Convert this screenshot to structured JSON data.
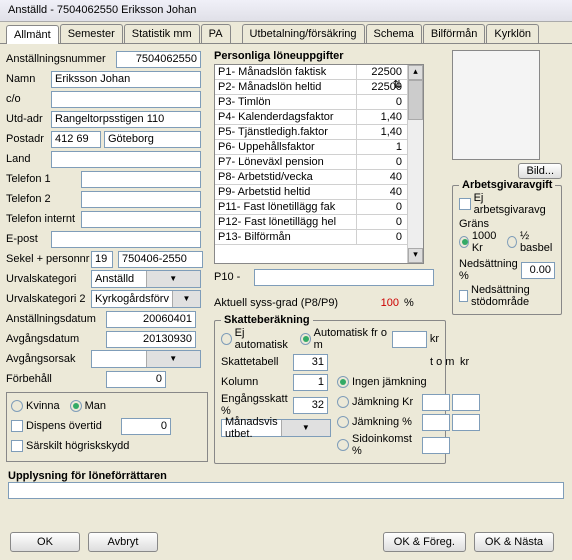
{
  "window": {
    "title": "Anställd - 7504062550  Eriksson Johan"
  },
  "tabs": [
    "Allmänt",
    "Semester",
    "Statistik mm",
    "PA",
    "Utbetalning/försäkring",
    "Schema",
    "Bilförmån",
    "Kyrklön"
  ],
  "active_tab": 0,
  "left": {
    "anst_nr_label": "Anställningsnummer",
    "anst_nr": "7504062550",
    "namn_label": "Namn",
    "namn": "Eriksson Johan",
    "co_label": "c/o",
    "co": "",
    "utd_label": "Utd-adr",
    "utd": "Rangeltorpsstigen 110",
    "post_label": "Postadr",
    "postnr": "412 69",
    "ort": "Göteborg",
    "land_label": "Land",
    "land": "",
    "tel1_label": "Telefon 1",
    "tel1": "",
    "tel2_label": "Telefon 2",
    "tel2": "",
    "telint_label": "Telefon internt",
    "telint": "",
    "epost_label": "E-post",
    "epost": "",
    "sekel_label": "Sekel + personnr",
    "sekel": "19",
    "pnr": "750406-2550",
    "urv1_label": "Urvalskategori",
    "urv1": "Anställd",
    "urv2_label": "Urvalskategori 2",
    "urv2": "Kyrkogårdsförv",
    "anstdat_label": "Anställningsdatum",
    "anstdat": "20060401",
    "avgdat_label": "Avgångsdatum",
    "avgdat": "20130930",
    "avgors_label": "Avgångsorsak",
    "avgors": "",
    "forb_label": "Förbehåll",
    "forb": "0",
    "kvinna_label": "Kvinna",
    "man_label": "Man",
    "dispens_label": "Dispens övertid",
    "dispens_val": "0",
    "hogrisk_label": "Särskilt högriskskydd"
  },
  "personliga": {
    "title": "Personliga löneuppgifter",
    "rows": [
      {
        "l": "P1- Månadslön faktisk",
        "v": "22500"
      },
      {
        "l": "P2- Månadslön heltid",
        "v": "22500"
      },
      {
        "l": "P3- Timlön",
        "v": "0"
      },
      {
        "l": "P4- Kalenderdagsfaktor",
        "v": "1,40"
      },
      {
        "l": "P5- Tjänstledigh.faktor",
        "v": "1,40"
      },
      {
        "l": "P6- Uppehållsfaktor",
        "v": "1"
      },
      {
        "l": "P7- Löneväxl pension",
        "v": "0"
      },
      {
        "l": "P8- Arbetstid/vecka",
        "v": "40"
      },
      {
        "l": "P9- Arbetstid heltid",
        "v": "40"
      },
      {
        "l": "P11- Fast lönetillägg fak",
        "v": "0"
      },
      {
        "l": "P12- Fast lönetillägg hel",
        "v": "0"
      },
      {
        "l": "P13- Bilförmån",
        "v": "0"
      }
    ],
    "p10_label": "P10 -",
    "aktuell_label": "Aktuell syss-grad (P8/P9)",
    "aktuell_val": "100",
    "aktuell_pct": "%"
  },
  "bild_btn": "Bild...",
  "arbgiv": {
    "title": "Arbetsgivaravgift",
    "ej_label": "Ej  arbetsgivaravg",
    "grans_label": "Gräns",
    "r1": "1000 Kr",
    "r2": "½ basbel",
    "neds_label": "Nedsättning %",
    "neds_val": "0.00",
    "stod_label": "Nedsättning stödområde"
  },
  "skatt": {
    "title": "Skatteberäkning",
    "ej_auto": "Ej automatisk",
    "auto_from": "Automatisk fr o m",
    "kr": "kr",
    "tabell_label": "Skattetabell",
    "tabell": "31",
    "kolumn_label": "Kolumn",
    "kolumn": "1",
    "engang_label": "Engångsskatt %",
    "engang": "32",
    "manad_label": "Månadsvis utbet.",
    "ingen": "Ingen jämkning",
    "jamkr": "Jämkning Kr",
    "jampc": "Jämkning %",
    "sido": "Sidoinkomst %",
    "tom": "t o m",
    "kr2": "kr"
  },
  "uppl_label": "Upplysning för löneförrättaren",
  "buttons": {
    "ok": "OK",
    "avbryt": "Avbryt",
    "foreg": "OK & Föreg.",
    "nasta": "OK & Nästa"
  }
}
